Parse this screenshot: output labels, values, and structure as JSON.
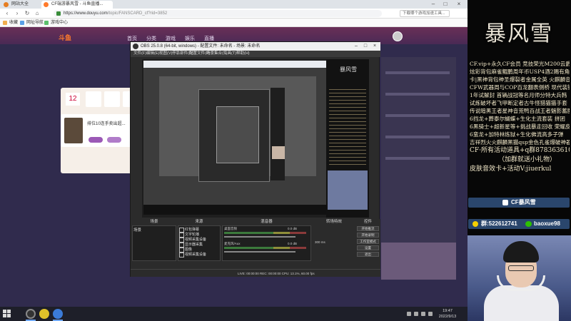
{
  "browser": {
    "tabs": [
      {
        "label": "网站大全"
      },
      {
        "label": "CF端游暴风雪 - 斗鱼直播..."
      }
    ],
    "url_host": "https://www.douyu.com",
    "url_path": "/topic/FANSCARD_cf?rid=3852",
    "search_placeholder": "下载哪个游戏加速工具...",
    "bookmarks": [
      {
        "label": "收藏"
      },
      {
        "label": "网址导航"
      },
      {
        "label": "游戏中心"
      }
    ]
  },
  "page": {
    "logo": "斗鱼",
    "nav": [
      "首页",
      "分类",
      "游戏",
      "娱乐",
      "直播"
    ],
    "fan_count": "12",
    "host_line1": "排位10连手卖出超...",
    "host_line2": "关注"
  },
  "obs": {
    "title": "OBS 25.0.8 (64-bit, windows) - 配置文件: 未命名 - 场景: 未命名",
    "menu": [
      "文件(F)",
      "编辑(E)",
      "视图(V)",
      "停靠部件(D)",
      "配置文件(P)",
      "场景集合(S)",
      "工具(T)",
      "帮助(H)"
    ],
    "preview_title": "暴风雪",
    "panels": {
      "scenes": "场景",
      "sources": "来源",
      "mixer": "混音器",
      "transitions": "转场特效",
      "controls": "控件"
    },
    "scene_name": "场景",
    "sources": [
      {
        "label": "红包弹幕"
      },
      {
        "label": "文字轮播"
      },
      {
        "label": "视频采集设备"
      },
      {
        "label": "显示器采集"
      },
      {
        "label": "图像"
      },
      {
        "label": "视频采集设备"
      }
    ],
    "mixer": [
      {
        "label": "桌面音频",
        "value": "0.0 dB"
      },
      {
        "label": "麦克风/Aux",
        "value": "0.0 dB"
      }
    ],
    "transition_duration": "300 ms",
    "controls": [
      "开始推流",
      "开始录制",
      "工作室模式",
      "设置",
      "退出"
    ],
    "status": "LIVE: 00:00:00   REC: 00:00:00   CPU: 13.1%, 60.00 fps"
  },
  "overlay": {
    "brand": "暴风雪",
    "promo_lines": [
      "CF.vip+永久CF会员 竞技荣光M200云爵",
      "炫彩背包麻雀鲲鹏周年币USP4酒2赐有角色",
      "卡|黑神背包神圣爆裂者金属全英 火麒麟音城",
      "CFW武器周与COP百龙翻表侧桥 现代装镇",
      "1年试解封 首辆战冠等名月师分特大兵韩",
      "试炼破坏者飞甲断定者古牛怪猎猫猫手套",
      "传说暗黑王者星神音荒鸭百战王者魅影蓄魔",
      "6挡龙+葬泰尔蝴蝶+生化主流套装 拼团",
      "6黑骑士+超新星等+挑战暴走回收 荣耀皮",
      "6蛮龙+加特林炼狱+生化佛流高多子弹",
      "吉祥烈火火麒麟黑猫qsp金色孔雀爆破神器"
    ],
    "promo_big": [
      "CF·所有活动道具+q群878363610",
      "（加群就送小礼物）",
      "皮肤音效卡+活动V:jiuerkul"
    ],
    "tiktok": "CF暴风雪",
    "qq_group": "群:522612741",
    "wechat": "baoxue98"
  },
  "taskbar": {
    "time": "19:47",
    "date": "2022/9/13"
  },
  "colors": {
    "obs_bg": "#2b2b2b",
    "page_bg": "#302b4d",
    "overlay_bg": "#070707",
    "social_blue": "#2a466c"
  }
}
